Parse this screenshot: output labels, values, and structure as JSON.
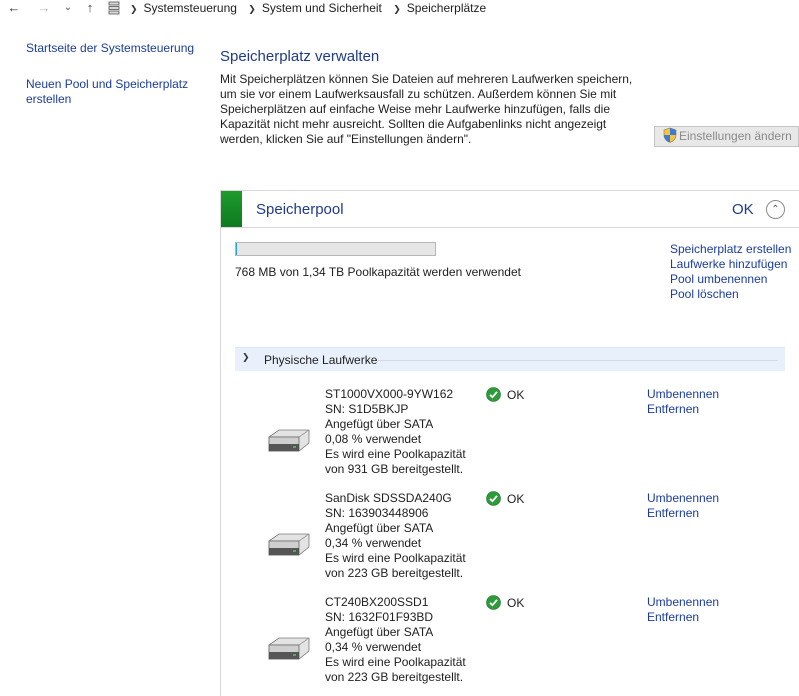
{
  "address": {
    "breadcrumbs": [
      "Systemsteuerung",
      "System und Sicherheit",
      "Speicherplätze"
    ]
  },
  "left_pane": {
    "home_link": "Startseite der Systemsteuerung",
    "new_pool_link": "Neuen Pool und Speicherplatz erstellen"
  },
  "main": {
    "title": "Speicherplatz verwalten",
    "intro": "Mit Speicherplätzen können Sie Dateien auf mehreren Laufwerken speichern, um sie vor einem Laufwerksausfall zu schützen. Außerdem können Sie mit Speicherplätzen auf einfache Weise mehr Laufwerke hinzufügen, falls die Kapazität nicht mehr ausreicht. Sollten die Aufgabenlinks nicht angezeigt werden, klicken Sie auf \"Einstellungen ändern\".",
    "settings_button": "Einstellungen ändern"
  },
  "pool": {
    "name": "Speicherpool",
    "status": "OK",
    "usage_text": "768 MB von 1,34 TB Poolkapazität werden verwendet",
    "usage_fraction": 0.0006,
    "tasks": [
      "Speicherplatz erstellen",
      "Laufwerke hinzufügen",
      "Pool umbenennen",
      "Pool löschen"
    ],
    "section_title": "Physische Laufwerke"
  },
  "drives": [
    {
      "model": "ST1000VX000-9YW162",
      "serial": "SN: S1D5BKJP",
      "connection": "Angefügt über SATA",
      "used": "0,08 % verwendet",
      "capacity_line1": "Es wird eine Poolkapazität",
      "capacity_line2": "von 931 GB bereitgestellt.",
      "status": "OK",
      "rename": "Umbenennen",
      "remove": "Entfernen"
    },
    {
      "model": "SanDisk SDSSDA240G",
      "serial": "SN: 163903448906",
      "connection": "Angefügt über SATA",
      "used": "0,34 % verwendet",
      "capacity_line1": "Es wird eine Poolkapazität",
      "capacity_line2": "von 223 GB bereitgestellt.",
      "status": "OK",
      "rename": "Umbenennen",
      "remove": "Entfernen"
    },
    {
      "model": "CT240BX200SSD1",
      "serial": "SN: 1632F01F93BD",
      "connection": "Angefügt über SATA",
      "used": "0,34 % verwendet",
      "capacity_line1": "Es wird eine Poolkapazität",
      "capacity_line2": "von 223 GB bereitgestellt.",
      "status": "OK",
      "rename": "Umbenennen",
      "remove": "Entfernen"
    }
  ]
}
